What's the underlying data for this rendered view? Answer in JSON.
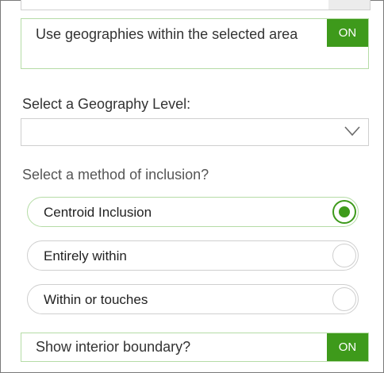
{
  "geographies_toggle": {
    "label": "Use geographies within the selected area",
    "state": "ON",
    "on": true
  },
  "geography_level": {
    "label": "Select a Geography Level:",
    "value": "",
    "icon": "chevron-down-icon"
  },
  "inclusion": {
    "label": "Select a method of inclusion?",
    "options": [
      {
        "label": "Centroid Inclusion",
        "selected": true
      },
      {
        "label": "Entirely within",
        "selected": false
      },
      {
        "label": "Within or touches",
        "selected": false
      }
    ]
  },
  "interior_boundary_toggle": {
    "label": "Show interior boundary?",
    "state": "ON",
    "on": true
  },
  "colors": {
    "accent": "#3e9a1b",
    "accent_border": "#b5dca6",
    "border": "#cfcfcf",
    "text": "#333333"
  }
}
